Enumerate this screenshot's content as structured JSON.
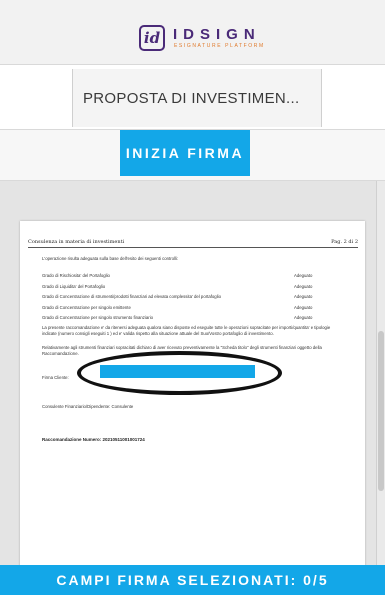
{
  "header": {
    "logo_mark": "id",
    "logo_name": "IDSIGN",
    "logo_subtitle": "ESIGNATURE PLATFORM"
  },
  "document": {
    "title": "PROPOSTA DI INVESTIMEN..."
  },
  "actions": {
    "start_sign_label": "INIZIA FIRMA"
  },
  "page": {
    "header_left": "Consulenza in materia di investimenti",
    "header_right": "Pag. 2 di 2",
    "intro": "L'operazione risulta adeguata sulla base dell'esito dei seguenti controlli:",
    "controls": [
      {
        "label": "Grado di Rischiosita' del Portafoglio",
        "value": "Adeguato"
      },
      {
        "label": "Grado di Liquidita' del Portafoglio",
        "value": "Adeguato"
      },
      {
        "label": "Grado di Concentrazione di strumenti/prodotti finanziari ad elevata complessita' del portafoglio",
        "value": "Adeguato"
      },
      {
        "label": "Grado di Concentrazione per singolo emittente",
        "value": "Adeguato"
      },
      {
        "label": "Grado di Concentrazione per singolo strumento finanziario",
        "value": "Adeguato"
      }
    ],
    "paragraph1": "La presente raccomandazione e' da ritenersi adeguata qualora siano disposte ed eseguite tutte le operazioni sopracitate per importi/quantita' e tipologie indicate (numero consigli eseguiti 1 ) ed e' valida rispetto alla situazione attuale del Suo/Vostro portafoglio di investimento.",
    "paragraph2": "Relativamente agli strumenti finanziari sopracitati dichiaro di aver ricevuto preventivamente la \"Scheda titolo\" degli strumenti finanziari oggetto della Raccomandazione.",
    "firma_label": "Firma Cliente:",
    "consultant_label": "Consulente Finanziario/Dipendente: Consulente",
    "recommendation_number": "Raccomandazione Numero: 20210511001001724"
  },
  "footer": {
    "status": "CAMPI FIRMA SELEZIONATI: 0/5"
  },
  "colors": {
    "accent": "#13a7e8",
    "brand": "#4a2a78",
    "brand_secondary": "#e07a2c"
  }
}
